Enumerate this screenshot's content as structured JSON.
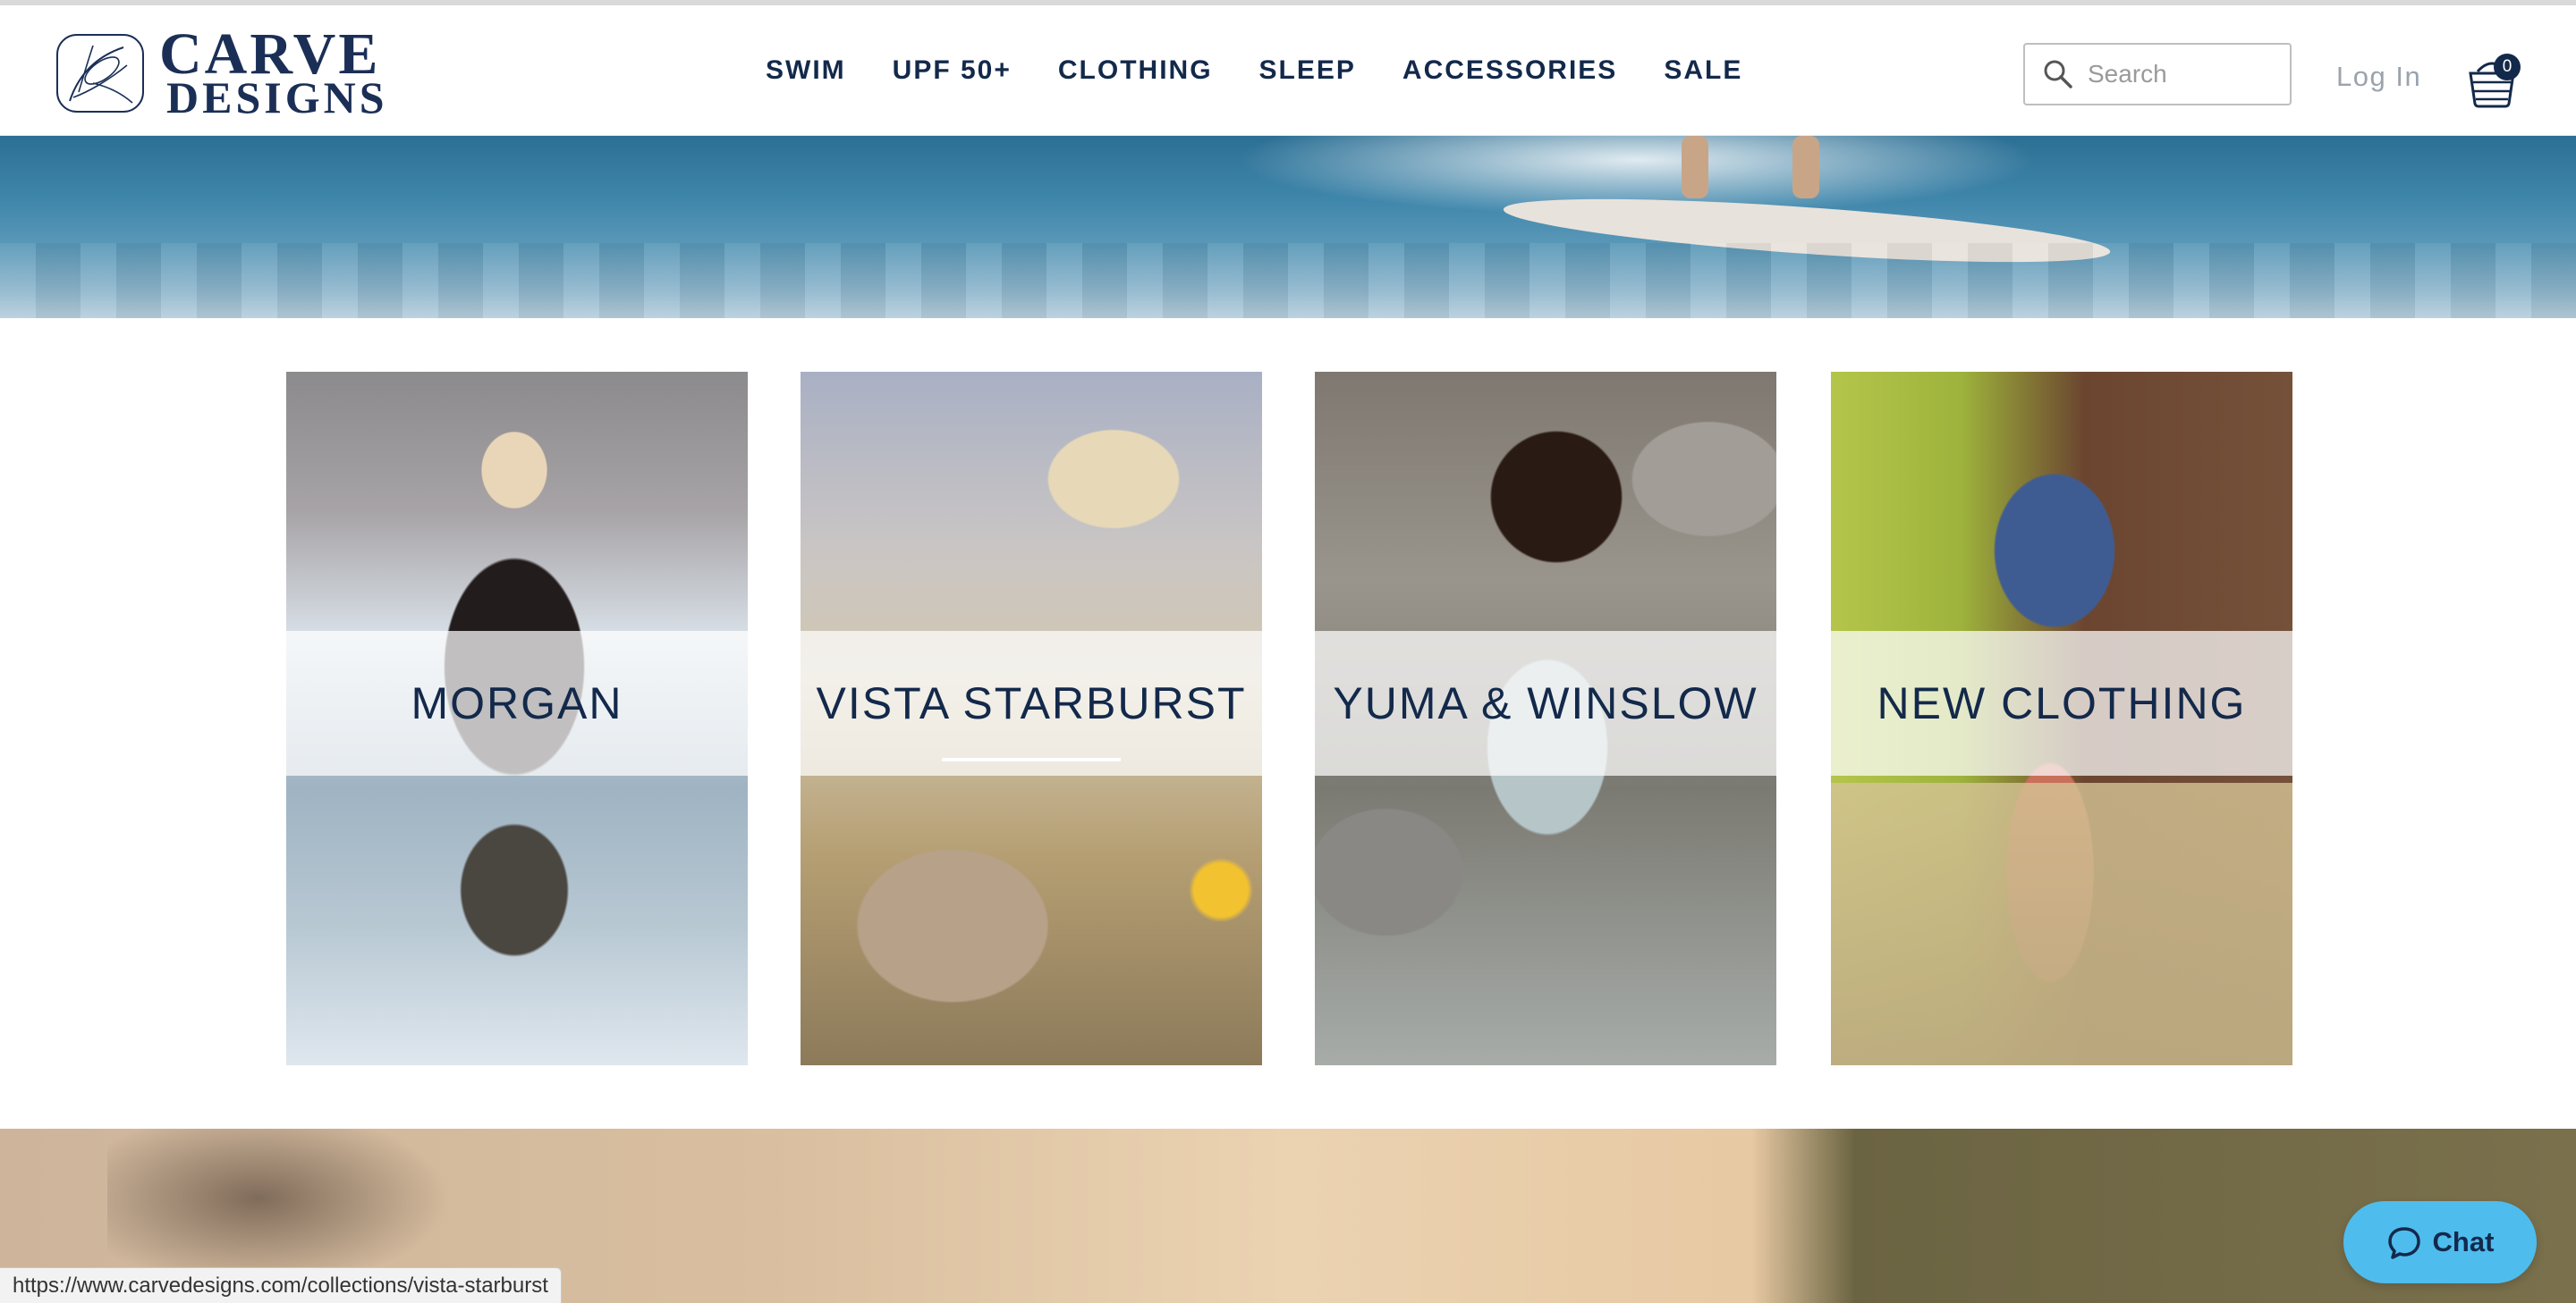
{
  "brand": {
    "line1": "CARVE",
    "line2": "DESIGNS"
  },
  "nav": {
    "items": [
      "SWIM",
      "UPF 50+",
      "CLOTHING",
      "SLEEP",
      "ACCESSORIES",
      "SALE"
    ]
  },
  "search": {
    "placeholder": "Search"
  },
  "account": {
    "login_label": "Log In"
  },
  "cart": {
    "count": "0"
  },
  "collections": [
    {
      "label": "MORGAN"
    },
    {
      "label": "VISTA STARBURST"
    },
    {
      "label": "YUMA & WINSLOW"
    },
    {
      "label": "NEW CLOTHING"
    }
  ],
  "status_bar": {
    "url": "https://www.carvedesigns.com/collections/vista-starburst"
  },
  "chat": {
    "label": "Chat"
  },
  "colors": {
    "navy": "#13294b",
    "chat_blue": "#4fbcee"
  }
}
